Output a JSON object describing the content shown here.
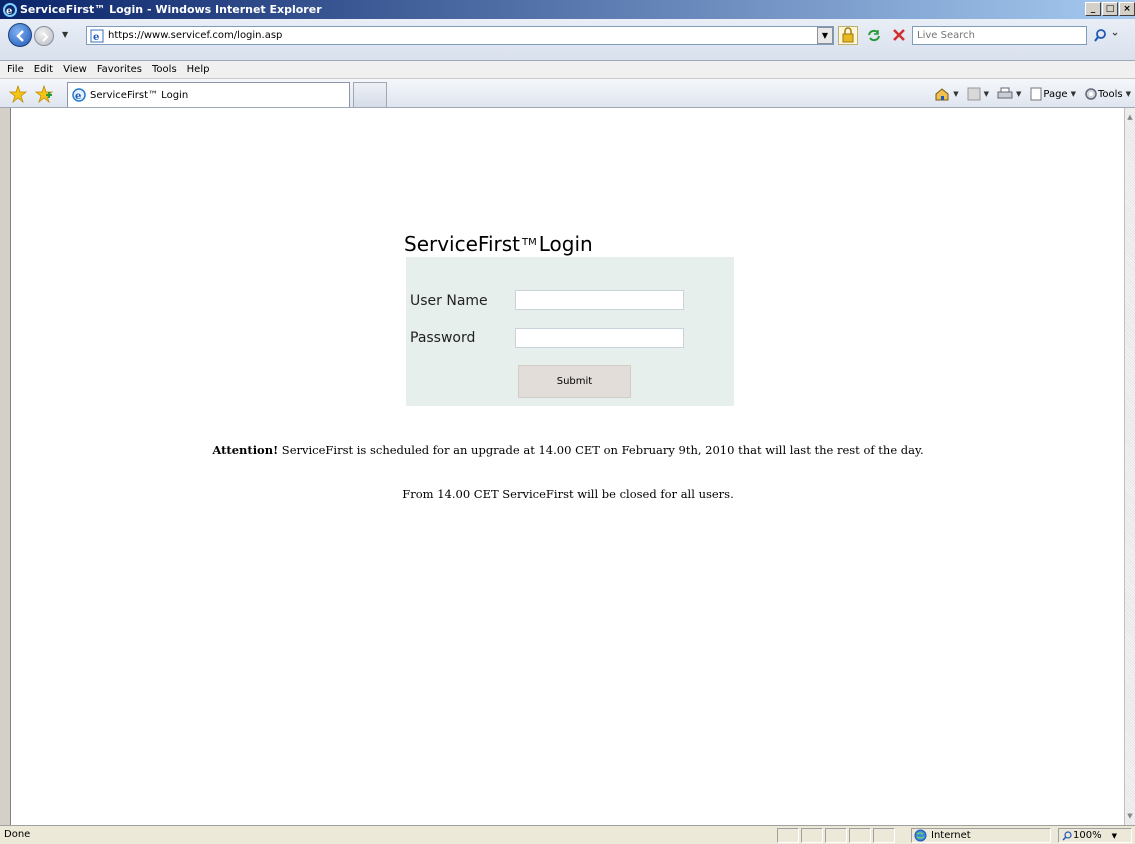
{
  "window": {
    "title": "ServiceFirst™ Login - Windows Internet Explorer",
    "min_label": "_",
    "max_label": "□",
    "close_label": "×"
  },
  "address": {
    "url": "https://www.servicef.com/login.asp",
    "search_placeholder": "Live Search"
  },
  "menu": {
    "items": [
      "File",
      "Edit",
      "View",
      "Favorites",
      "Tools",
      "Help"
    ]
  },
  "tab": {
    "label": "ServiceFirst™ Login"
  },
  "commandbar": {
    "page_label": "Page",
    "tools_label": "Tools"
  },
  "login": {
    "title_main": "ServiceFirst",
    "title_tm": "TM",
    "title_suffix": "Login",
    "username_label": "User Name",
    "username_value": "",
    "password_label": "Password",
    "password_value": "",
    "submit_label": "Submit"
  },
  "notice": {
    "attention": "Attention!",
    "line1": " ServiceFirst is scheduled for an upgrade at 14.00 CET on February 9th, 2010 that will last the rest of the day.",
    "line2": "From 14.00 CET ServiceFirst will be closed for all users."
  },
  "status": {
    "text": "Done",
    "zone": "Internet",
    "zoom": "100%"
  }
}
